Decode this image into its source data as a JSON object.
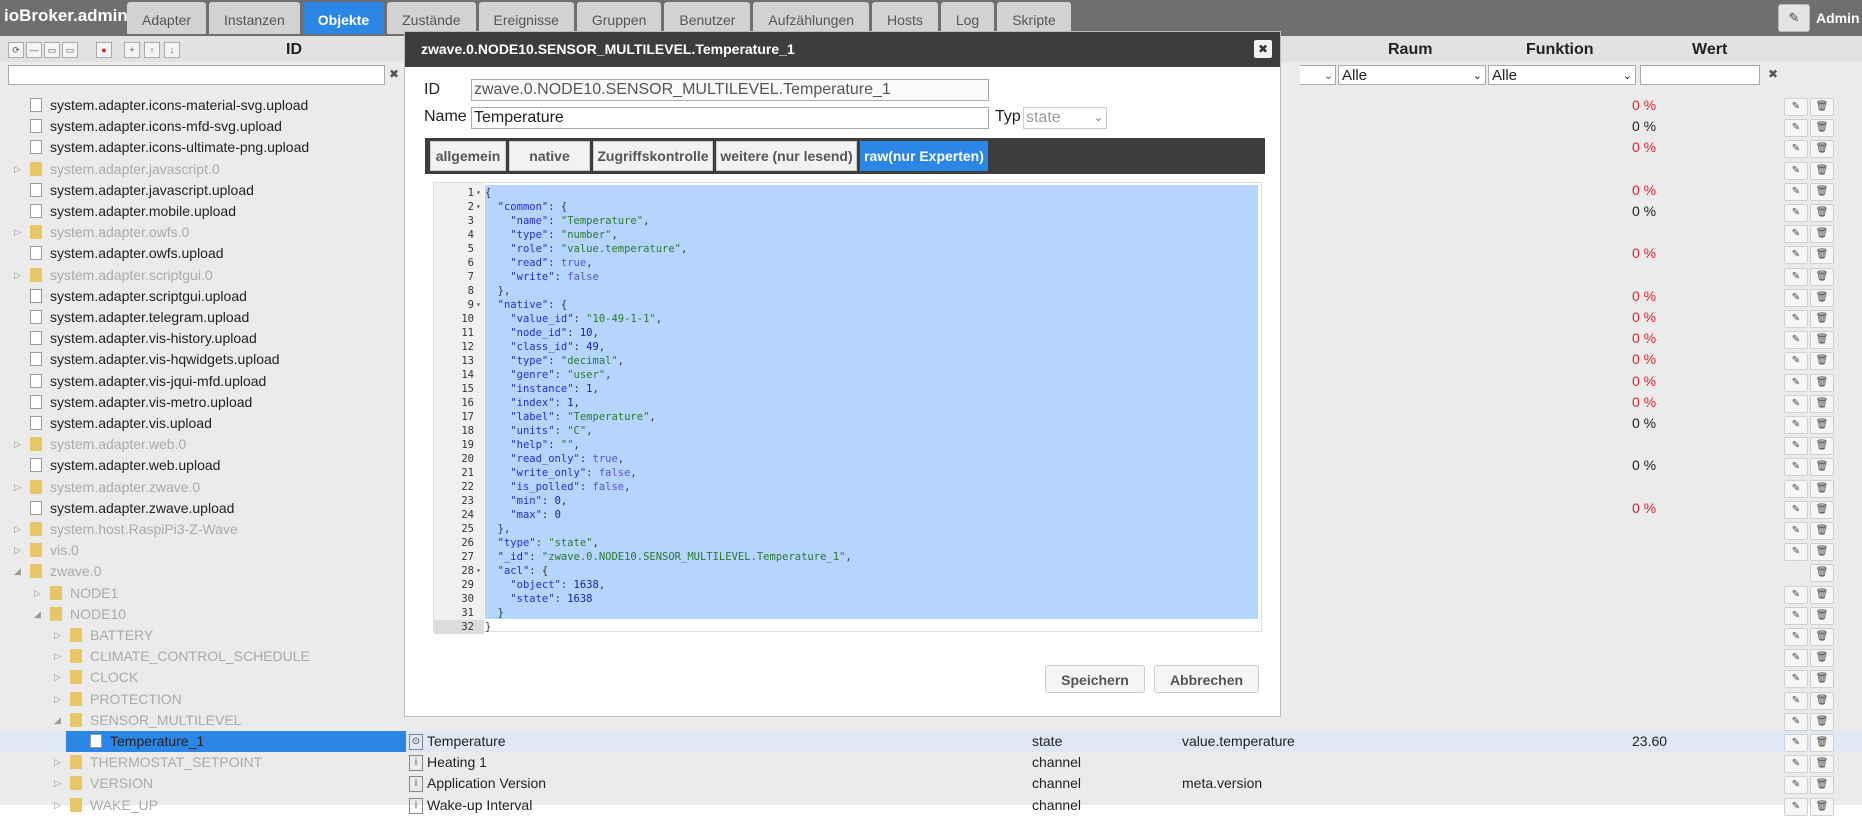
{
  "brand": "ioBroker.admin",
  "tabs": [
    "Adapter",
    "Instanzen",
    "Objekte",
    "Zustände",
    "Ereignisse",
    "Gruppen",
    "Benutzer",
    "Aufzählungen",
    "Hosts",
    "Log",
    "Skripte"
  ],
  "active_tab": "Objekte",
  "user_label": "Admin",
  "columns": {
    "id": "ID",
    "raum": "Raum",
    "funktion": "Funktion",
    "wert": "Wert"
  },
  "filters": {
    "raum": "Alle",
    "funktion": "Alle"
  },
  "rows": [
    {
      "name": "system.adapter.icons-material-svg.upload",
      "icon": "file",
      "dim": false,
      "depth": 1,
      "value": "0 %",
      "red": true
    },
    {
      "name": "system.adapter.icons-mfd-svg.upload",
      "icon": "file",
      "dim": false,
      "depth": 1,
      "value": "0 %",
      "red": false
    },
    {
      "name": "system.adapter.icons-ultimate-png.upload",
      "icon": "file",
      "dim": false,
      "depth": 1,
      "value": "0 %",
      "red": true
    },
    {
      "name": "system.adapter.javascript.0",
      "icon": "folder",
      "dim": true,
      "depth": 1,
      "toggle": "▷",
      "value": "",
      "red": false
    },
    {
      "name": "system.adapter.javascript.upload",
      "icon": "file",
      "dim": false,
      "depth": 1,
      "value": "0 %",
      "red": true
    },
    {
      "name": "system.adapter.mobile.upload",
      "icon": "file",
      "dim": false,
      "depth": 1,
      "value": "0 %",
      "red": false
    },
    {
      "name": "system.adapter.owfs.0",
      "icon": "folder",
      "dim": true,
      "depth": 1,
      "toggle": "▷",
      "value": "",
      "red": false
    },
    {
      "name": "system.adapter.owfs.upload",
      "icon": "file",
      "dim": false,
      "depth": 1,
      "value": "0 %",
      "red": true
    },
    {
      "name": "system.adapter.scriptgui.0",
      "icon": "folder",
      "dim": true,
      "depth": 1,
      "toggle": "▷",
      "value": "",
      "red": false
    },
    {
      "name": "system.adapter.scriptgui.upload",
      "icon": "file",
      "dim": false,
      "depth": 1,
      "value": "0 %",
      "red": true
    },
    {
      "name": "system.adapter.telegram.upload",
      "icon": "file",
      "dim": false,
      "depth": 1,
      "value": "0 %",
      "red": true
    },
    {
      "name": "system.adapter.vis-history.upload",
      "icon": "file",
      "dim": false,
      "depth": 1,
      "value": "0 %",
      "red": true
    },
    {
      "name": "system.adapter.vis-hqwidgets.upload",
      "icon": "file",
      "dim": false,
      "depth": 1,
      "value": "0 %",
      "red": true
    },
    {
      "name": "system.adapter.vis-jqui-mfd.upload",
      "icon": "file",
      "dim": false,
      "depth": 1,
      "value": "0 %",
      "red": true
    },
    {
      "name": "system.adapter.vis-metro.upload",
      "icon": "file",
      "dim": false,
      "depth": 1,
      "value": "0 %",
      "red": true
    },
    {
      "name": "system.adapter.vis.upload",
      "icon": "file",
      "dim": false,
      "depth": 1,
      "value": "0 %",
      "red": false
    },
    {
      "name": "system.adapter.web.0",
      "icon": "folder",
      "dim": true,
      "depth": 1,
      "toggle": "▷",
      "value": "",
      "red": false
    },
    {
      "name": "system.adapter.web.upload",
      "icon": "file",
      "dim": false,
      "depth": 1,
      "value": "0 %",
      "red": false
    },
    {
      "name": "system.adapter.zwave.0",
      "icon": "folder",
      "dim": true,
      "depth": 1,
      "toggle": "▷",
      "value": "",
      "red": false
    },
    {
      "name": "system.adapter.zwave.upload",
      "icon": "file",
      "dim": false,
      "depth": 1,
      "value": "0 %",
      "red": true
    },
    {
      "name": "system.host.RaspiPi3-Z-Wave",
      "icon": "folder",
      "dim": true,
      "depth": 1,
      "toggle": "▷",
      "value": "",
      "red": false
    },
    {
      "name": "vis.0",
      "icon": "folder",
      "dim": true,
      "depth": 1,
      "toggle": "▷",
      "value": "",
      "red": false
    },
    {
      "name": "zwave.0",
      "icon": "folder",
      "dim": true,
      "depth": 1,
      "toggle": "◢",
      "value": "",
      "red": false,
      "noedit": true
    },
    {
      "name": "NODE1",
      "icon": "folder",
      "dim": true,
      "depth": 2,
      "toggle": "▷",
      "value": "",
      "red": false
    },
    {
      "name": "NODE10",
      "icon": "folder",
      "dim": true,
      "depth": 2,
      "toggle": "◢",
      "value": "",
      "red": false
    },
    {
      "name": "BATTERY",
      "icon": "folder",
      "dim": true,
      "depth": 3,
      "toggle": "▷",
      "value": "",
      "red": false
    },
    {
      "name": "CLIMATE_CONTROL_SCHEDULE",
      "icon": "folder",
      "dim": true,
      "depth": 3,
      "toggle": "▷",
      "value": "",
      "red": false
    },
    {
      "name": "CLOCK",
      "icon": "folder",
      "dim": true,
      "depth": 3,
      "toggle": "▷",
      "value": "",
      "red": false
    },
    {
      "name": "PROTECTION",
      "icon": "folder",
      "dim": true,
      "depth": 3,
      "toggle": "▷",
      "value": "",
      "red": false
    },
    {
      "name": "SENSOR_MULTILEVEL",
      "icon": "folder",
      "dim": true,
      "depth": 3,
      "toggle": "◢",
      "value": "",
      "red": false
    },
    {
      "name": "Temperature_1",
      "icon": "file",
      "dim": false,
      "depth": 4,
      "selected": true,
      "col_name": "Temperature",
      "col_type": "state",
      "col_role": "value.temperature",
      "value": "23.60",
      "red": false
    },
    {
      "name": "THERMOSTAT_SETPOINT",
      "icon": "folder",
      "dim": true,
      "depth": 3,
      "toggle": "▷",
      "col_name": "Heating 1",
      "col_type": "channel",
      "col_role": "",
      "value": "",
      "red": false
    },
    {
      "name": "VERSION",
      "icon": "folder",
      "dim": true,
      "depth": 3,
      "toggle": "▷",
      "col_name": "Application Version",
      "col_type": "channel",
      "col_role": "meta.version",
      "value": "",
      "red": false
    },
    {
      "name": "WAKE_UP",
      "icon": "folder",
      "dim": true,
      "depth": 3,
      "toggle": "▷",
      "col_name": "Wake-up Interval",
      "col_type": "channel",
      "col_role": "",
      "value": "",
      "red": false
    }
  ],
  "dialog": {
    "title": "zwave.0.NODE10.SENSOR_MULTILEVEL.Temperature_1",
    "id_label": "ID",
    "id_value": "zwave.0.NODE10.SENSOR_MULTILEVEL.Temperature_1",
    "name_label": "Name",
    "name_value": "Temperature",
    "typ_label": "Typ",
    "typ_value": "state",
    "tabs": [
      "allgemein",
      "native",
      "Zugriffskontrolle",
      "weitere (nur lesend)",
      "raw(nur Experten)"
    ],
    "active_tab": "raw(nur Experten)",
    "save_label": "Speichern",
    "cancel_label": "Abbrechen",
    "code_lines": [
      "{",
      "  \"common\": {",
      "    \"name\": \"Temperature\",",
      "    \"type\": \"number\",",
      "    \"role\": \"value.temperature\",",
      "    \"read\": true,",
      "    \"write\": false",
      "  },",
      "  \"native\": {",
      "    \"value_id\": \"10-49-1-1\",",
      "    \"node_id\": 10,",
      "    \"class_id\": 49,",
      "    \"type\": \"decimal\",",
      "    \"genre\": \"user\",",
      "    \"instance\": 1,",
      "    \"index\": 1,",
      "    \"label\": \"Temperature\",",
      "    \"units\": \"C\",",
      "    \"help\": \"\",",
      "    \"read_only\": true,",
      "    \"write_only\": false,",
      "    \"is_polled\": false,",
      "    \"min\": 0,",
      "    \"max\": 0",
      "  },",
      "  \"type\": \"state\",",
      "  \"_id\": \"zwave.0.NODE10.SENSOR_MULTILEVEL.Temperature_1\",",
      "  \"acl\": {",
      "    \"object\": 1638,",
      "    \"state\": 1638",
      "  }",
      "}"
    ],
    "fold_lines": [
      1,
      2,
      9,
      28
    ]
  }
}
